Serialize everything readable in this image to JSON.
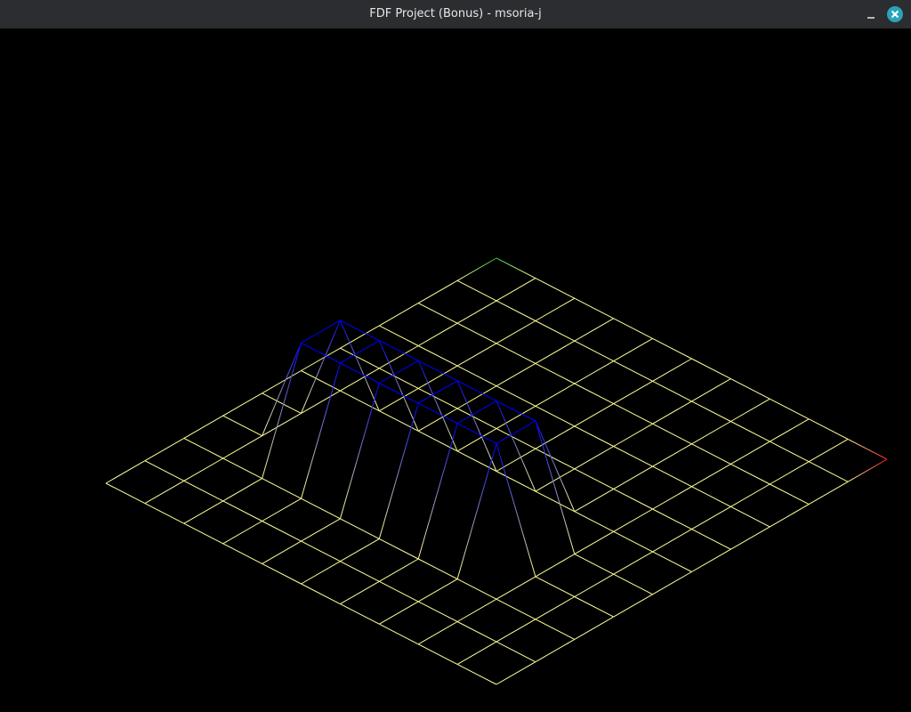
{
  "window": {
    "title": "FDF Project (Bonus) - msoria-j",
    "minimize_icon": "minimize-icon",
    "close_icon": "close-icon",
    "close_color": "#29a3b8"
  },
  "fdf_map": {
    "cols": 11,
    "rows": 11,
    "heights": [
      [
        0,
        0,
        0,
        0,
        0,
        0,
        0,
        0,
        0,
        0,
        0
      ],
      [
        0,
        0,
        0,
        0,
        0,
        0,
        0,
        0,
        0,
        0,
        0
      ],
      [
        0,
        0,
        0,
        0,
        0,
        0,
        0,
        0,
        0,
        0,
        0
      ],
      [
        0,
        0,
        0,
        0,
        0,
        0,
        0,
        0,
        0,
        0,
        0
      ],
      [
        0,
        0,
        0,
        0,
        0,
        0,
        0,
        0,
        0,
        0,
        0
      ],
      [
        0,
        0,
        0,
        0,
        0,
        0,
        0,
        0,
        0,
        0,
        0
      ],
      [
        0,
        0,
        10,
        10,
        10,
        10,
        10,
        10,
        0,
        0,
        0
      ],
      [
        0,
        0,
        10,
        10,
        10,
        10,
        10,
        10,
        0,
        0,
        0
      ],
      [
        0,
        0,
        0,
        0,
        0,
        0,
        0,
        0,
        0,
        0,
        0
      ],
      [
        0,
        0,
        0,
        0,
        0,
        0,
        0,
        0,
        0,
        0,
        0
      ],
      [
        0,
        0,
        0,
        0,
        0,
        0,
        0,
        0,
        0,
        0,
        0
      ]
    ],
    "color_low": "#ffff99",
    "color_high": "#0000ff",
    "corner_colors": {
      "top": "#33cc33",
      "right": "#ff2222"
    }
  }
}
